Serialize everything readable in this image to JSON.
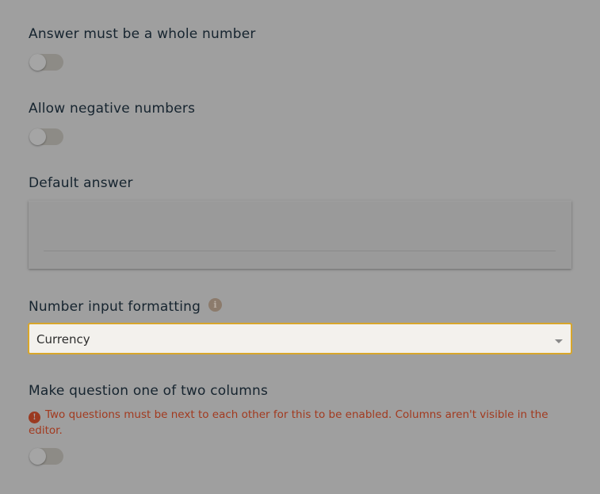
{
  "fields": {
    "whole_number": {
      "label": "Answer must be a whole number",
      "enabled": false
    },
    "negative_numbers": {
      "label": "Allow negative numbers",
      "enabled": false
    },
    "default_answer": {
      "label": "Default answer",
      "value": ""
    },
    "number_formatting": {
      "label": "Number input formatting",
      "info_icon": "info-icon",
      "info_glyph": "i",
      "selected": "Currency"
    },
    "two_columns": {
      "label": "Make question one of two columns",
      "error_icon": "alert-icon",
      "error_glyph": "!",
      "error": "Two questions must be next to each other for this to be enabled. Columns aren't visible in the editor.",
      "enabled": false
    }
  },
  "colors": {
    "focus_border": "#d8a62a",
    "error_text": "#a23a1f"
  }
}
